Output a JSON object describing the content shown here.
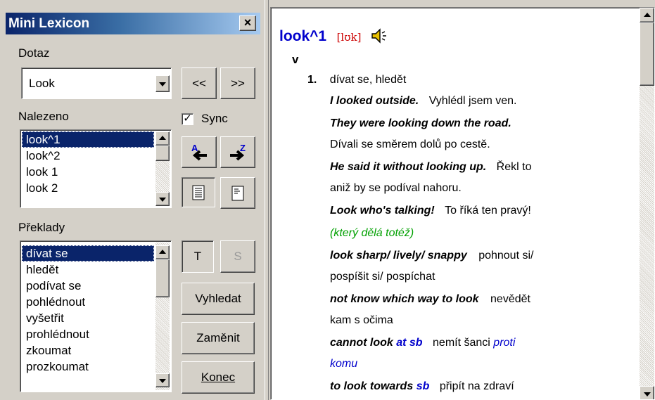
{
  "window": {
    "title": "Mini Lexicon",
    "close_label": "×"
  },
  "query": {
    "label": "Dotaz",
    "value": "Look",
    "prev_label": "<<",
    "next_label": ">>"
  },
  "found": {
    "label": "Nalezeno",
    "sync_label": "Sync",
    "sync_checked": true,
    "items": [
      "look^1",
      "look^2",
      "look 1",
      "look 2"
    ],
    "selected_index": 0
  },
  "translations": {
    "label": "Překlady",
    "items": [
      "dívat se",
      "hledět",
      "podívat se",
      "pohlédnout",
      "vyšetřit",
      "prohlédnout",
      "zkoumat",
      "prozkoumat"
    ],
    "selected_index": 0
  },
  "buttons": {
    "t_label": "T",
    "s_label": "S",
    "search_label": "Vyhledat",
    "swap_label": "Zaměnit",
    "end_label": "Konec"
  },
  "icons": {
    "sort_az": "sort-a-left-icon",
    "sort_za": "sort-z-right-icon",
    "view_full": "view-full-text-icon",
    "view_page": "view-page-icon",
    "speaker": "speaker-icon"
  },
  "entry": {
    "headword": "look^1",
    "phonetic": "[lʊk]",
    "pos": "v",
    "sense_number": "1.",
    "sense_translation": "dívat se, hledět",
    "lines": [
      {
        "ex": "I looked outside.",
        "tr": "Vyhlédl jsem ven."
      },
      {
        "ex": "They were looking down the road.",
        "tr": ""
      },
      {
        "ex": "",
        "tr": "Dívali se směrem dolů po cestě."
      },
      {
        "ex": "He said it without looking up.",
        "tr": "Řekl to"
      },
      {
        "ex": "",
        "tr": "aniž  by se podíval nahoru."
      },
      {
        "ex": "Look who's talking!",
        "tr": "To říká ten pravý!"
      },
      {
        "ex": "",
        "tr": "",
        "note": "(který dělá totéž)"
      },
      {
        "ex": "look sharp/ lively/ snappy",
        "tr": "pohnout si/"
      },
      {
        "ex": "",
        "tr": "pospíšit  si/ pospíchat"
      },
      {
        "ex": "not know which way to look",
        "tr": "nevědět"
      },
      {
        "ex": "",
        "tr": "kam  s očima"
      },
      {
        "ex": "cannot look",
        "ex_obj": "at sb",
        "tr": "nemít šanci",
        "tr_obj": "proti"
      },
      {
        "ex": "",
        "tr": "",
        "tr_obj_line": "komu"
      },
      {
        "ex": "to look towards",
        "ex_obj": "sb",
        "tr": "připít na zdraví"
      }
    ]
  },
  "colors": {
    "titlebar_start": "#0a246a",
    "titlebar_end": "#a6caf0",
    "selection": "#0a246a",
    "headword": "#0000cc",
    "phonetic": "#cc0000",
    "note": "#00a000"
  }
}
